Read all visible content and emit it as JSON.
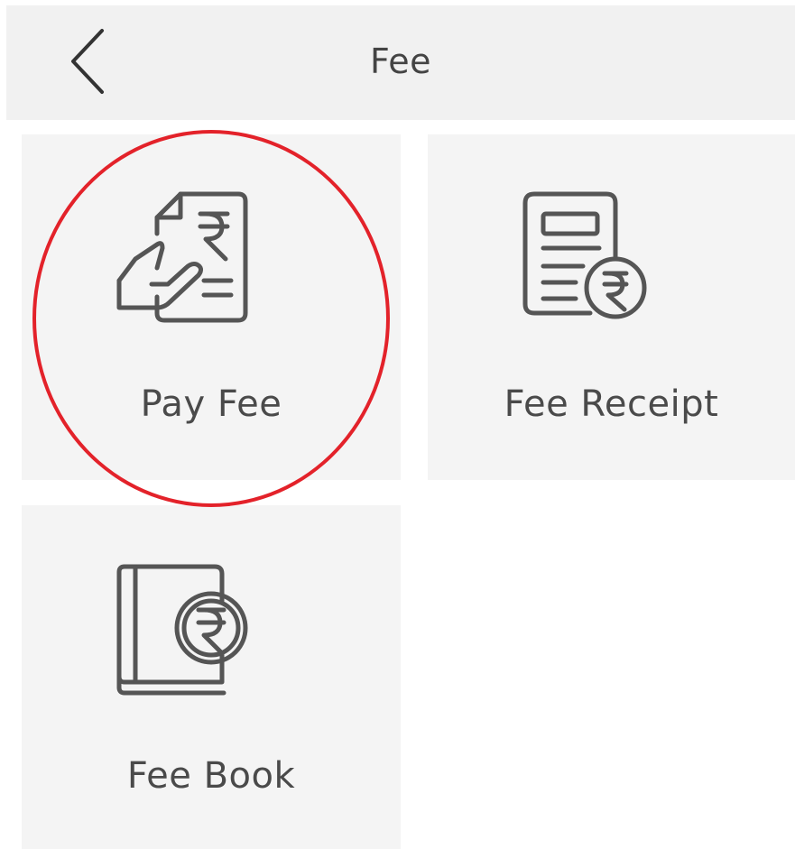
{
  "header": {
    "title": "Fee",
    "back_icon": "chevron-left-icon"
  },
  "tiles": [
    {
      "label": "Pay Fee",
      "icon": "pay-fee-icon"
    },
    {
      "label": "Fee Receipt",
      "icon": "receipt-icon"
    },
    {
      "label": "Fee Book",
      "icon": "fee-book-icon"
    }
  ],
  "colors": {
    "header_bg": "#f1f1f1",
    "tile_bg": "#f4f4f4",
    "icon_stroke": "#555555",
    "text": "#444444",
    "highlight": "#e3222a"
  }
}
